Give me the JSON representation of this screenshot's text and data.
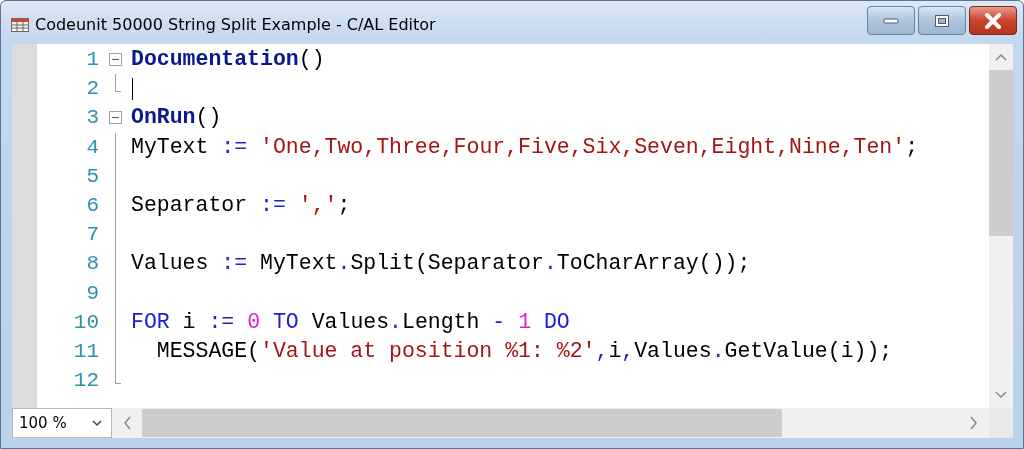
{
  "window": {
    "title": "Codeunit 50000 String Split Example - C/AL Editor"
  },
  "lines": [
    {
      "number": "1",
      "kind": "fold-start",
      "expanded": true,
      "caret": false,
      "tokens": [
        {
          "kind": "trigger",
          "text": "Documentation"
        },
        {
          "kind": "plain",
          "text": "()"
        }
      ]
    },
    {
      "number": "2",
      "kind": "fold-end",
      "caret": true
    },
    {
      "number": "3",
      "kind": "fold-start",
      "expanded": true,
      "caret": false,
      "tokens": [
        {
          "kind": "trigger",
          "text": "OnRun"
        },
        {
          "kind": "plain",
          "text": "()"
        }
      ]
    },
    {
      "number": "4",
      "kind": "fold-body",
      "caret": false,
      "tokens": [
        {
          "kind": "plain",
          "text": "MyText "
        },
        {
          "kind": "operator",
          "text": ":= "
        },
        {
          "kind": "string",
          "text": "'One,Two,Three,Four,Five,Six,Seven,Eight,Nine,Ten'"
        },
        {
          "kind": "plain",
          "text": ";"
        }
      ]
    },
    {
      "number": "5",
      "kind": "fold-body",
      "caret": false
    },
    {
      "number": "6",
      "kind": "fold-body",
      "caret": false,
      "tokens": [
        {
          "kind": "plain",
          "text": "Separator "
        },
        {
          "kind": "operator",
          "text": ":= "
        },
        {
          "kind": "string",
          "text": "','"
        },
        {
          "kind": "plain",
          "text": ";"
        }
      ]
    },
    {
      "number": "7",
      "kind": "fold-body",
      "caret": false
    },
    {
      "number": "8",
      "kind": "fold-body",
      "caret": false,
      "tokens": [
        {
          "kind": "plain",
          "text": "Values "
        },
        {
          "kind": "operator",
          "text": ":="
        },
        {
          "kind": "plain",
          "text": " MyText"
        },
        {
          "kind": "operator",
          "text": "."
        },
        {
          "kind": "plain",
          "text": "Split(Separator"
        },
        {
          "kind": "operator",
          "text": "."
        },
        {
          "kind": "plain",
          "text": "ToCharArray());"
        }
      ]
    },
    {
      "number": "9",
      "kind": "fold-body",
      "caret": false
    },
    {
      "number": "10",
      "kind": "fold-body",
      "caret": false,
      "tokens": [
        {
          "kind": "keyword",
          "text": "FOR"
        },
        {
          "kind": "plain",
          "text": " i "
        },
        {
          "kind": "operator",
          "text": ":= "
        },
        {
          "kind": "number",
          "text": "0"
        },
        {
          "kind": "keyword",
          "text": " TO"
        },
        {
          "kind": "plain",
          "text": " Values"
        },
        {
          "kind": "operator",
          "text": "."
        },
        {
          "kind": "plain",
          "text": "Length "
        },
        {
          "kind": "operator",
          "text": "- "
        },
        {
          "kind": "number",
          "text": "1"
        },
        {
          "kind": "keyword",
          "text": " DO"
        }
      ]
    },
    {
      "number": "11",
      "kind": "fold-body",
      "caret": false,
      "tokens": [
        {
          "kind": "plain",
          "text": "  MESSAGE("
        },
        {
          "kind": "string",
          "text": "'Value at position %1: %2'"
        },
        {
          "kind": "operator",
          "text": ","
        },
        {
          "kind": "plain",
          "text": "i"
        },
        {
          "kind": "operator",
          "text": ","
        },
        {
          "kind": "plain",
          "text": "Values"
        },
        {
          "kind": "operator",
          "text": "."
        },
        {
          "kind": "plain",
          "text": "GetValue(i));"
        }
      ]
    },
    {
      "number": "12",
      "kind": "fold-end",
      "caret": false
    }
  ],
  "zoom": {
    "value": "100 %"
  }
}
